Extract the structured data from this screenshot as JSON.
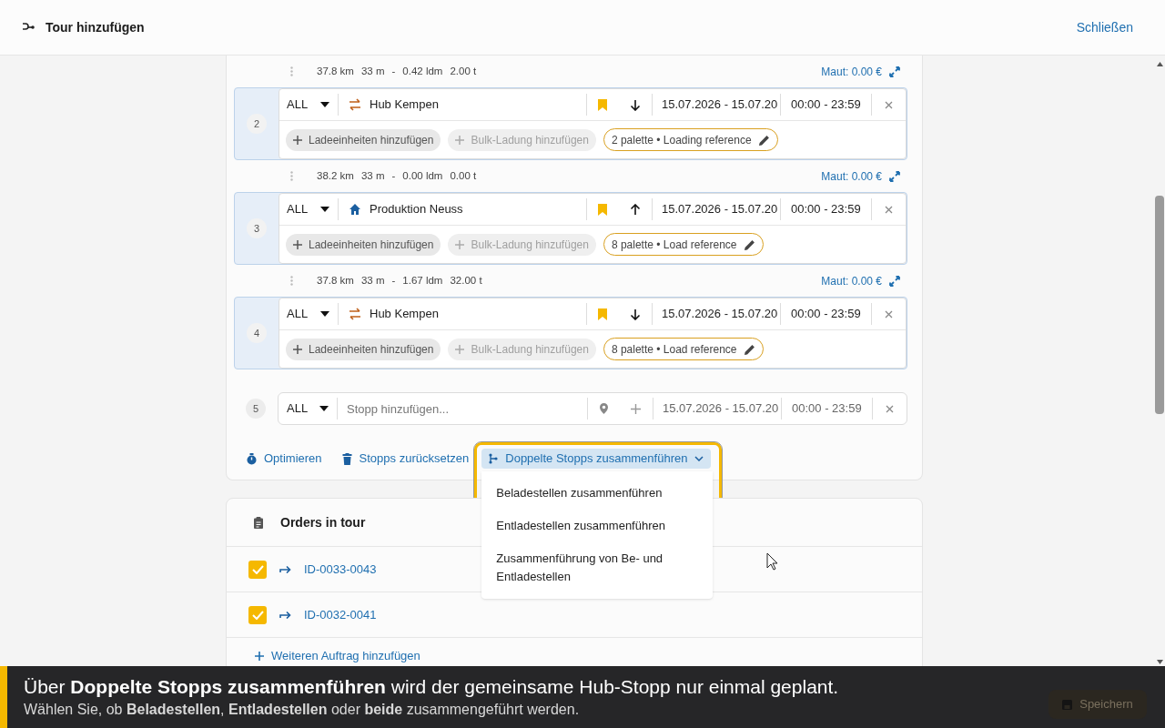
{
  "header": {
    "title": "Tour hinzufügen",
    "close_label": "Schließen"
  },
  "route": [
    {
      "kind": "leg",
      "distance": "37.8 km",
      "duration": "33 m",
      "separator": "-",
      "ldm": "0.42 ldm",
      "weight": "2.00 t",
      "toll": "Maut: 0.00 €"
    },
    {
      "kind": "stop",
      "number": "2",
      "mode": "ALL",
      "icon": {
        "kind": "hub"
      },
      "name": "Hub Kempen",
      "arrow": {
        "kind": "down"
      },
      "date": "15.07.2026 - 15.07.20",
      "time": "00:00 - 23:59",
      "units_label": "Ladeeinheiten hinzufügen",
      "bulk_label": "Bulk-Ladung hinzufügen",
      "reference": "2 palette • Loading reference"
    },
    {
      "kind": "leg",
      "distance": "38.2 km",
      "duration": "33 m",
      "separator": "-",
      "ldm": "0.00 ldm",
      "weight": "0.00 t",
      "toll": "Maut: 0.00 €"
    },
    {
      "kind": "stop",
      "number": "3",
      "mode": "ALL",
      "icon": {
        "kind": "home"
      },
      "name": "Produktion Neuss",
      "arrow": {
        "kind": "up"
      },
      "date": "15.07.2026 - 15.07.20",
      "time": "00:00 - 23:59",
      "units_label": "Ladeeinheiten hinzufügen",
      "bulk_label": "Bulk-Ladung hinzufügen",
      "reference": "8 palette • Load reference"
    },
    {
      "kind": "leg",
      "distance": "37.8 km",
      "duration": "33 m",
      "separator": "-",
      "ldm": "1.67 ldm",
      "weight": "32.00 t",
      "toll": "Maut: 0.00 €"
    },
    {
      "kind": "stop",
      "number": "4",
      "mode": "ALL",
      "icon": {
        "kind": "hub"
      },
      "name": "Hub Kempen",
      "arrow": {
        "kind": "down"
      },
      "date": "15.07.2026 - 15.07.20",
      "time": "00:00 - 23:59",
      "units_label": "Ladeeinheiten hinzufügen",
      "bulk_label": "Bulk-Ladung hinzufügen",
      "reference": "8 palette • Load reference"
    },
    {
      "kind": "new",
      "number": "5",
      "mode": "ALL",
      "placeholder": "Stopp hinzufügen...",
      "date": "15.07.2026 - 15.07.20",
      "time": "00:00 - 23:59"
    }
  ],
  "actions": [
    {
      "kind": "optimize",
      "label": "Optimieren"
    },
    {
      "kind": "reset",
      "label": "Stopps zurücksetzen"
    }
  ],
  "merge_menu": {
    "label": "Doppelte Stopps zusammenführen",
    "expanded": true,
    "options": [
      "Beladestellen zusammenführen",
      "Entladestellen zusammenführen",
      "Zusammenführung von Be- und Entladestellen"
    ]
  },
  "orders": {
    "title": "Orders in tour",
    "items": [
      {
        "id": "ID-0033-0043",
        "checked": true
      },
      {
        "id": "ID-0032-0041",
        "checked": true
      }
    ],
    "add_label": "Weiteren Auftrag hinzufügen"
  },
  "banner": {
    "line_1": "Über **Doppelte Stopps zusammenführen** wird der gemeinsame Hub-Stopp nur einmal geplant.",
    "line_2": "Wählen Sie, ob **Beladestellen**, **Entladestellen** oder **beide** zusammengeführt werden."
  },
  "save_button": {
    "label": "Speichern"
  }
}
